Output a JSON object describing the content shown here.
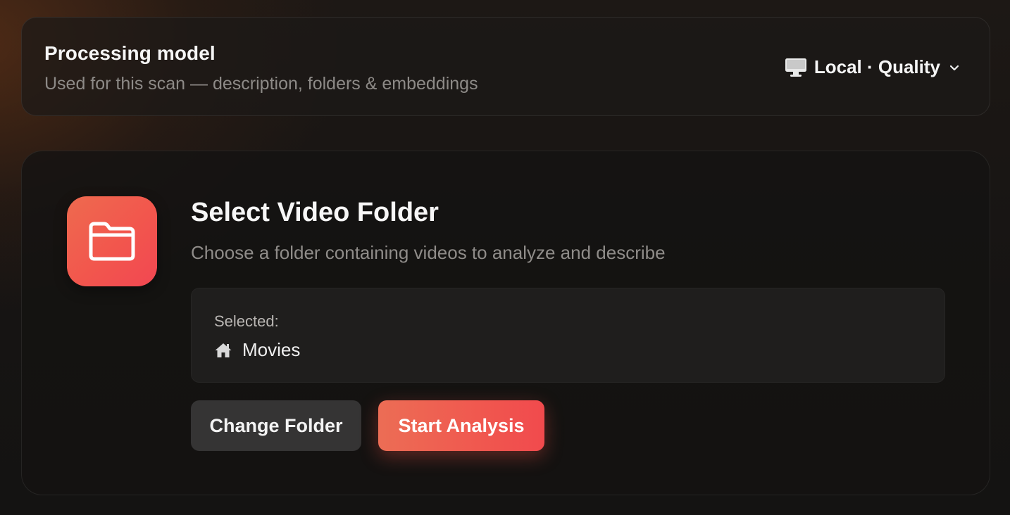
{
  "processing_model": {
    "title": "Processing model",
    "subtitle": "Used for this scan — description, folders & embeddings",
    "selector": {
      "icon": "monitor-icon",
      "label": "Local · Quality",
      "chevron": "chevron-down-icon"
    }
  },
  "folder_panel": {
    "icon": "folder-icon",
    "title": "Select Video Folder",
    "subtitle": "Choose a folder containing videos to analyze and describe",
    "selected": {
      "label": "Selected:",
      "icon": "home-icon",
      "value": "Movies"
    },
    "buttons": {
      "change": "Change Folder",
      "start": "Start Analysis"
    }
  },
  "colors": {
    "accent": "#f0584f",
    "accent_start": "#ec6d55",
    "secondary_button": "#353434"
  }
}
